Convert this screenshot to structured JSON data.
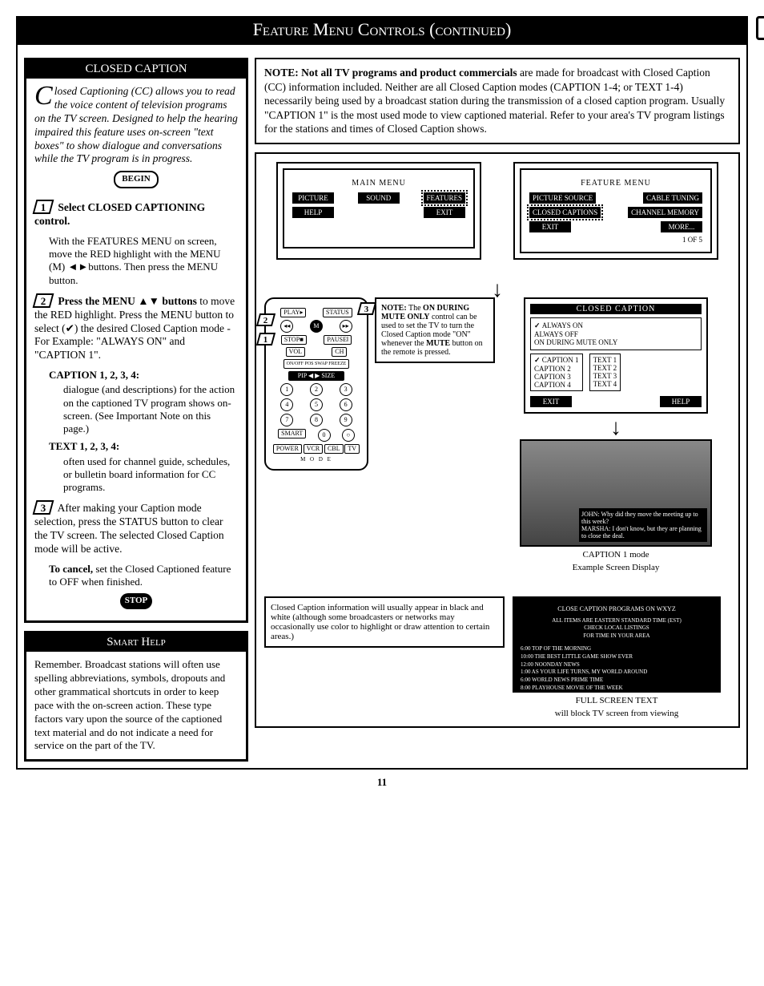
{
  "titleBar": "Feature Menu Controls (continued)",
  "cc": {
    "title": "CLOSED CAPTION",
    "intro": "Closed Captioning (CC) allows you to read the voice content of television programs on the TV screen. Designed to help the hearing impaired this feature uses on-screen \"text boxes\" to show dialogue and conversations while the TV program is in progress.",
    "begin": "BEGIN",
    "step1_head": "Select CLOSED CAPTIONING control.",
    "step1_body": "With the FEATURES MENU on screen, move the RED highlight with the MENU (M) ◄►buttons. Then press the MENU button.",
    "step2_head": "Press the MENU ▲▼ buttons",
    "step2_body": "to move the RED highlight. Press the MENU button to select (✔) the desired Closed Caption mode - For Example: \"ALWAYS ON\" and \"CAPTION 1\".",
    "cap_head": "CAPTION 1, 2, 3, 4:",
    "cap_body": "dialogue (and descriptions) for the action on the captioned TV program shows on-screen. (See Important Note on this page.)",
    "txt_head": "TEXT 1, 2, 3, 4:",
    "txt_body": "often used for channel guide, schedules, or bulletin board information for CC programs.",
    "step3_body": "After making your Caption mode selection, press the STATUS button to clear the TV screen. The selected Closed Caption mode will be active.",
    "cancel": "To cancel, set the Closed Captioned feature to OFF when finished.",
    "stop": "STOP"
  },
  "smart": {
    "title": "Smart Help",
    "body": "Remember. Broadcast stations will often use spelling abbreviations, symbols, dropouts and other grammatical shortcuts in order to keep pace with the on-screen action. These type factors vary upon the source of the captioned text material and do not indicate a need for service on the part of the TV."
  },
  "noteBox": "NOTE: Not all TV programs and product commercials are made for broadcast with Closed Caption (CC) information included. Neither are all Closed Caption modes (CAPTION 1-4; or TEXT 1-4) necessarily being used by a broadcast station during the transmission of a closed caption program. Usually \"CAPTION 1\" is the most used mode to view captioned material. Refer to your area's TV program listings for the stations and times of Closed Caption shows.",
  "mainMenu": {
    "label": "MAIN MENU",
    "items": [
      "PICTURE",
      "SOUND",
      "FEATURES",
      "HELP",
      "EXIT"
    ]
  },
  "featureMenu": {
    "label": "FEATURE MENU",
    "items": [
      "PICTURE SOURCE",
      "CABLE TUNING",
      "CLOSED CAPTIONS",
      "CHANNEL MEMORY",
      "EXIT",
      "MORE..."
    ],
    "pager": "1 OF 5"
  },
  "ccMenu": {
    "title": "CLOSED CAPTION",
    "row1": [
      "ALWAYS ON",
      "ALWAYS OFF",
      "ON DURING MUTE ONLY"
    ],
    "colA": [
      "CAPTION 1",
      "CAPTION 2",
      "CAPTION 3",
      "CAPTION 4"
    ],
    "colB": [
      "TEXT 1",
      "TEXT 2",
      "TEXT 3",
      "TEXT 4"
    ],
    "exit": "EXIT",
    "help": "HELP"
  },
  "muteNote": "NOTE: The ON DURING MUTE ONLY control can be used to set the TV to turn the Closed Caption mode \"ON\" whenever the MUTE button on the remote is pressed.",
  "sceneCap": "JOHN: Why did they move the meeting up to this week?\nMARSHA: I don't know, but they are planning to close the deal.",
  "sceneLabel1": "CAPTION 1 mode",
  "sceneLabel2": "Example Screen Display",
  "footNote": "Closed Caption information will usually appear in black and white (although some broadcasters or networks may occasionally use color to highlight or draw attention to certain areas.)",
  "fullScreen": {
    "line1": "CLOSE CAPTION PROGRAMS ON WXYZ",
    "line2": "ALL ITEMS ARE EASTERN STANDARD TIME (EST)\nCHECK LOCAL LISTINGS\nFOR TIME IN YOUR AREA",
    "sched": "6:00  TOP OF THE MORNING\n10:00  THE BEST LITTLE GAME SHOW EVER\n12:00  NOONDAY NEWS\n1:00  AS YOUR LIFE TURNS, MY WORLD AROUND\n6:00  WORLD NEWS PRIME TIME\n8:00  PLAYHOUSE MOVIE OF THE WEEK"
  },
  "fullLabel1": "FULL SCREEN TEXT",
  "fullLabel2": "will block TV screen from viewing",
  "pageNum": "11"
}
